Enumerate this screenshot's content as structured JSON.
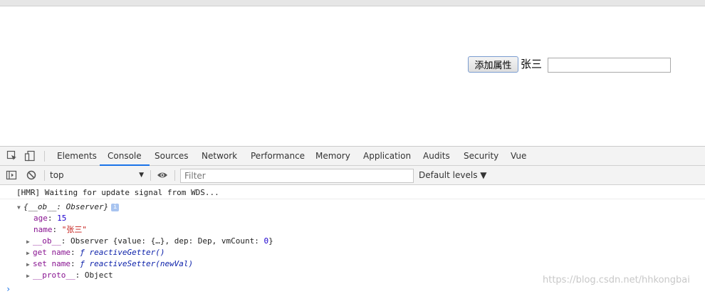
{
  "page": {
    "add_button_label": "添加属性",
    "name_text": "张三",
    "name_input_value": ""
  },
  "devtools": {
    "tabs": [
      "Elements",
      "Console",
      "Sources",
      "Network",
      "Performance",
      "Memory",
      "Application",
      "Audits",
      "Security",
      "Vue"
    ],
    "active_tab": "Console",
    "accent_color": "#1a73e8",
    "toolbar": {
      "context": "top",
      "filter_placeholder": "Filter",
      "levels": "Default levels ▼"
    },
    "console": {
      "hmr_message": "[HMR] Waiting for update signal from WDS...",
      "object_header": "{__ob__: Observer}",
      "info_badge": "i",
      "props": {
        "age_key": "age",
        "age_value": "15",
        "name_key": "name",
        "name_value": "\"张三\""
      },
      "ob_line": {
        "key": "__ob__",
        "value_prefix": "Observer {value: {…}, dep: Dep, vmCount: ",
        "vmcount": "0",
        "value_suffix": "}"
      },
      "getter_line": {
        "key": "get name",
        "value": "ƒ reactiveGetter()"
      },
      "setter_line": {
        "key": "set name",
        "value": "ƒ reactiveSetter(newVal)"
      },
      "proto_line": {
        "key": "__proto__",
        "value": "Object"
      },
      "prompt": "›"
    }
  },
  "watermark": "https://blog.csdn.net/hhkongbai"
}
